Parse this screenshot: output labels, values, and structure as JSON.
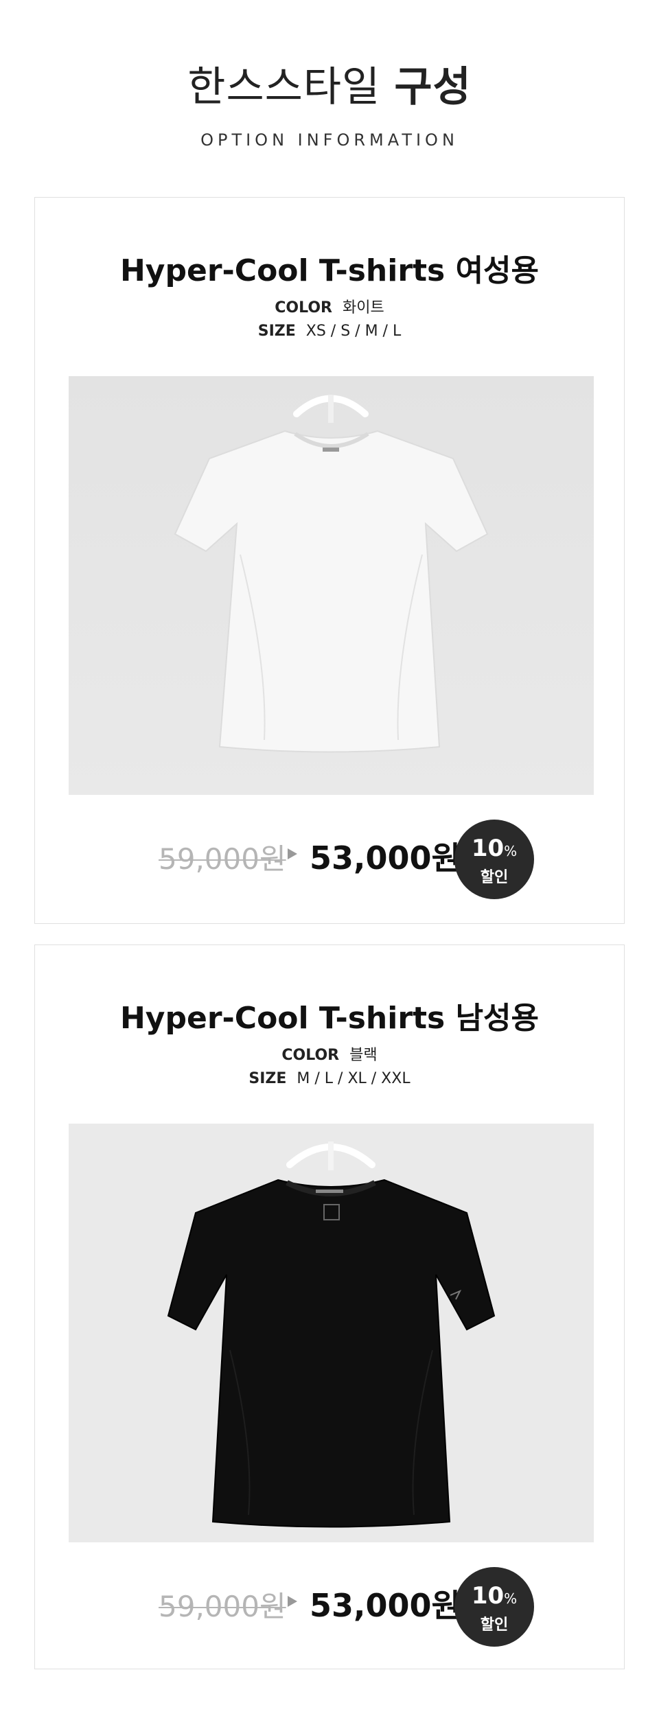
{
  "header": {
    "title_light": "한스스타일",
    "title_bold": "구성",
    "subtitle": "OPTION INFORMATION"
  },
  "products": [
    {
      "name": "Hyper-Cool T-shirts 여성용",
      "color_label": "COLOR",
      "color_value": "화이트",
      "size_label": "SIZE",
      "size_value": "XS / S / M / L",
      "old_price": "59,000원",
      "new_price": "53,000원",
      "discount_pct": "10",
      "discount_unit": "%",
      "discount_label": "할인",
      "shirt_color": "#f6f6f6"
    },
    {
      "name": "Hyper-Cool T-shirts 남성용",
      "color_label": "COLOR",
      "color_value": "블랙",
      "size_label": "SIZE",
      "size_value": "M / L / XL / XXL",
      "old_price": "59,000원",
      "new_price": "53,000원",
      "discount_pct": "10",
      "discount_unit": "%",
      "discount_label": "할인",
      "shirt_color": "#0d0d0d"
    }
  ],
  "colors": {
    "badge_bg": "#2a2a2a",
    "old_price": "#b5b5b5",
    "card_border": "#e0e0e0"
  }
}
